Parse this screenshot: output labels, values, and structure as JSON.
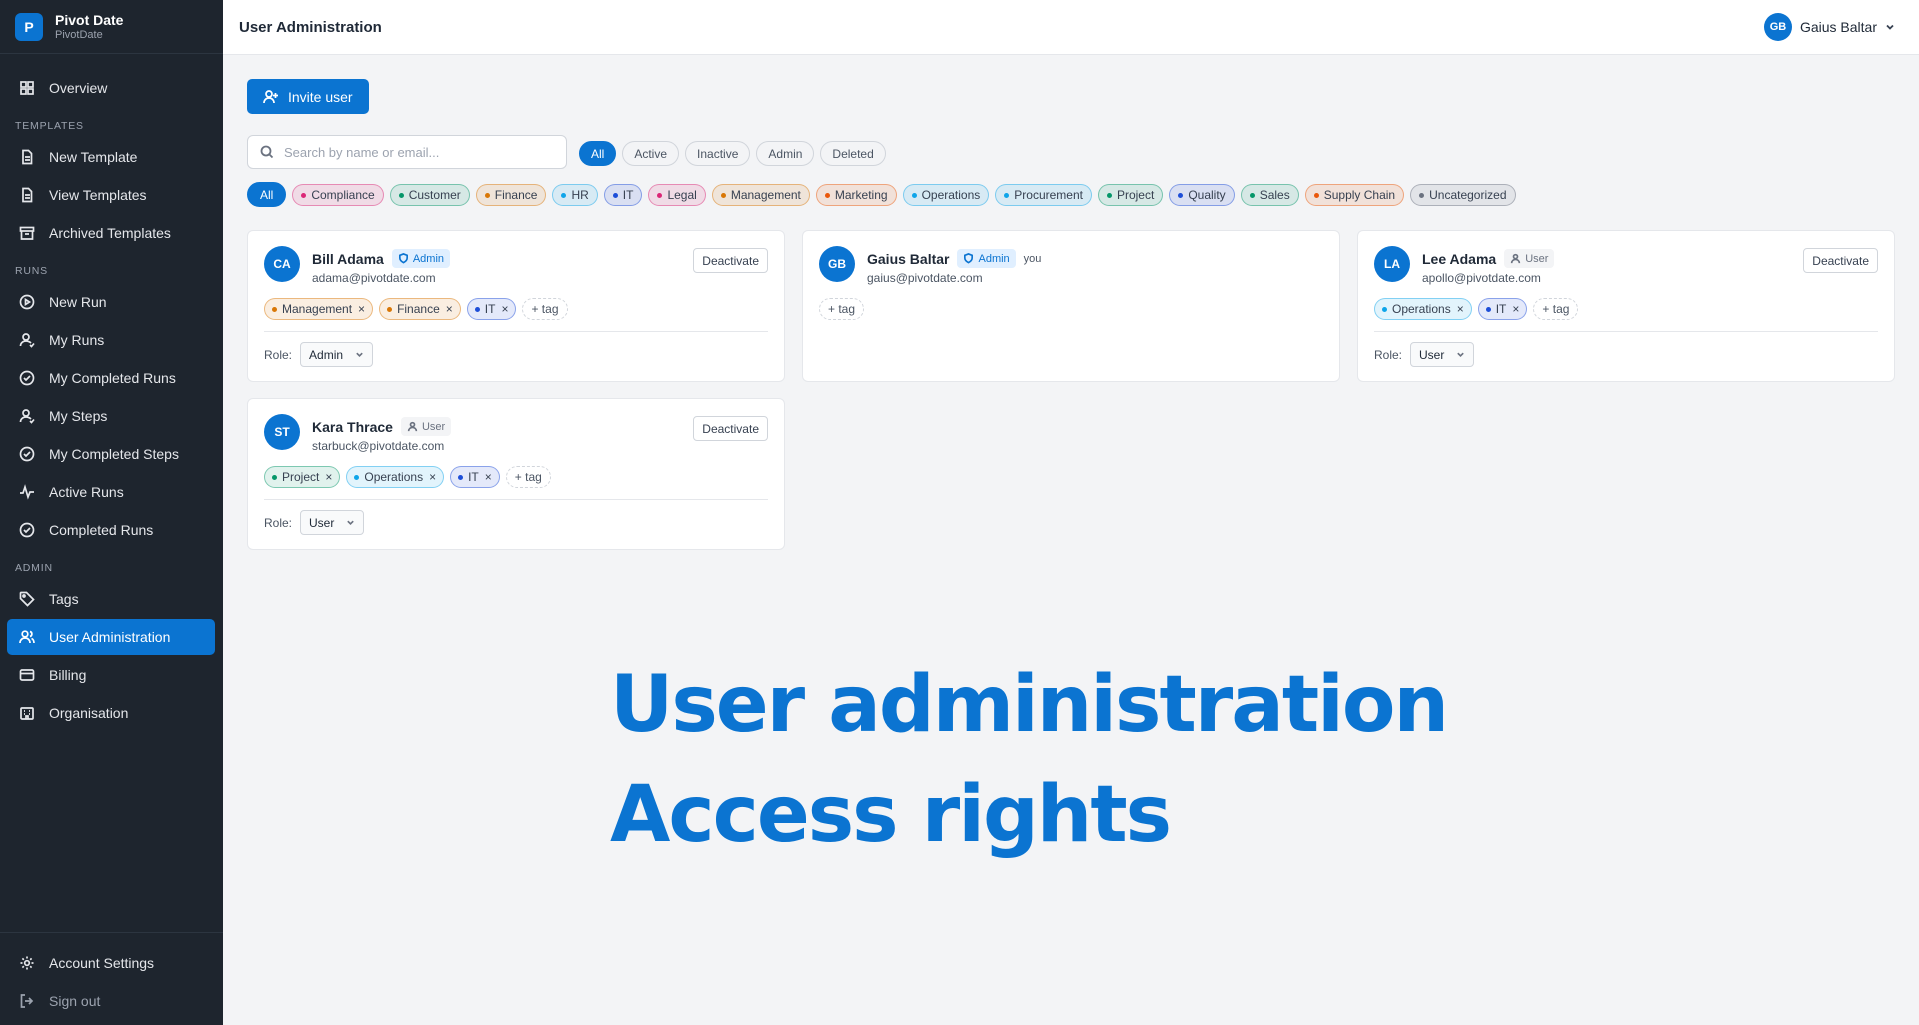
{
  "brand": {
    "logo_letter": "P",
    "name": "Pivot Date",
    "org": "PivotDate"
  },
  "sidebar": {
    "overview": "Overview",
    "sections": {
      "templates": "TEMPLATES",
      "runs": "RUNS",
      "admin": "ADMIN"
    },
    "templates": [
      "New Template",
      "View Templates",
      "Archived Templates"
    ],
    "runs": [
      "New Run",
      "My Runs",
      "My Completed Runs",
      "My Steps",
      "My Completed Steps",
      "Active Runs",
      "Completed Runs"
    ],
    "admin": [
      "Tags",
      "User Administration",
      "Billing",
      "Organisation"
    ],
    "bottom": [
      "Account Settings",
      "Sign out"
    ]
  },
  "header": {
    "title": "User Administration",
    "user_initials": "GB",
    "user_name": "Gaius Baltar"
  },
  "toolbar": {
    "invite_label": "Invite user",
    "search_placeholder": "Search by name or email..."
  },
  "status_filters": [
    "All",
    "Active",
    "Inactive",
    "Admin",
    "Deleted"
  ],
  "tag_filters": {
    "all": "All",
    "items": [
      {
        "label": "Compliance",
        "color": "#db2777"
      },
      {
        "label": "Customer",
        "color": "#059669"
      },
      {
        "label": "Finance",
        "color": "#d97706"
      },
      {
        "label": "HR",
        "color": "#0ea5e9"
      },
      {
        "label": "IT",
        "color": "#1d4ed8"
      },
      {
        "label": "Legal",
        "color": "#db2777"
      },
      {
        "label": "Management",
        "color": "#d97706"
      },
      {
        "label": "Marketing",
        "color": "#ea580c"
      },
      {
        "label": "Operations",
        "color": "#0ea5e9"
      },
      {
        "label": "Procurement",
        "color": "#0ea5e9"
      },
      {
        "label": "Project",
        "color": "#059669"
      },
      {
        "label": "Quality",
        "color": "#1d4ed8"
      },
      {
        "label": "Sales",
        "color": "#059669"
      },
      {
        "label": "Supply Chain",
        "color": "#ea580c"
      },
      {
        "label": "Uncategorized",
        "color": "#6b7280"
      }
    ]
  },
  "users": [
    {
      "initials": "CA",
      "name": "Bill Adama",
      "role_badge": "Admin",
      "email": "adama@pivotdate.com",
      "tags": [
        "Management",
        "Finance",
        "IT"
      ],
      "role_label": "Role:",
      "role": "Admin",
      "deactivate": "Deactivate"
    },
    {
      "initials": "GB",
      "name": "Gaius Baltar",
      "role_badge": "Admin",
      "you": "you",
      "email": "gaius@pivotdate.com",
      "tags": []
    },
    {
      "initials": "LA",
      "name": "Lee Adama",
      "role_badge": "User",
      "email": "apollo@pivotdate.com",
      "tags": [
        "Operations",
        "IT"
      ],
      "role_label": "Role:",
      "role": "User",
      "deactivate": "Deactivate"
    },
    {
      "initials": "ST",
      "name": "Kara Thrace",
      "role_badge": "User",
      "email": "starbuck@pivotdate.com",
      "tags": [
        "Project",
        "Operations",
        "IT"
      ],
      "role_label": "Role:",
      "role": "User",
      "deactivate": "Deactivate"
    }
  ],
  "add_tag_label": "+ tag",
  "remove_glyph": "×",
  "overlay": {
    "line1": "User administration",
    "line2": "Access rights"
  },
  "colors": {
    "accent": "#0b74d1",
    "sidebar_bg": "#1e252e",
    "page_bg": "#f3f4f6"
  }
}
